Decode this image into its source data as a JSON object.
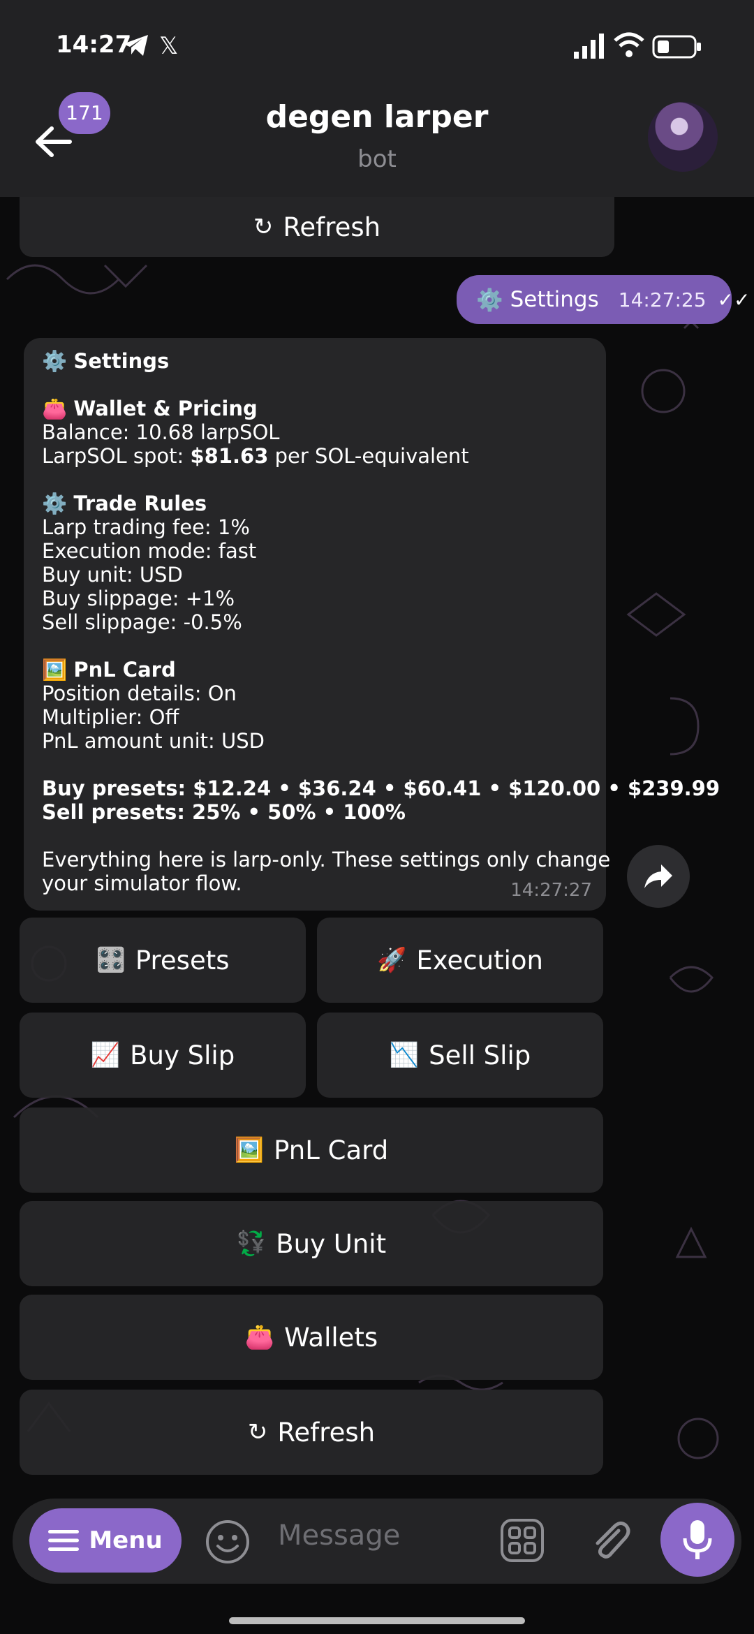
{
  "status": {
    "time": "14:27"
  },
  "header": {
    "badge": "171",
    "title": "degen larper",
    "subtitle": "bot"
  },
  "top_button": {
    "label": "Refresh",
    "icon": "↻"
  },
  "outgoing": {
    "icon": "⚙️",
    "text": "Settings",
    "time": "14:27:25"
  },
  "message": {
    "heading": "Settings",
    "wallet_heading": "Wallet & Pricing",
    "balance": "Balance: 10.68 larpSOL",
    "spot_prefix": "LarpSOL spot: ",
    "spot_value": "$81.63",
    "spot_suffix": " per SOL-equivalent",
    "rules_heading": "Trade Rules",
    "fee": "Larp trading fee: 1%",
    "exec": "Execution mode: fast",
    "buy_unit": "Buy unit: USD",
    "buy_slip": "Buy slippage: +1%",
    "sell_slip": "Sell slippage: -0.5%",
    "pnl_heading": "PnL Card",
    "position": "Position details: On",
    "multiplier": "Multiplier: Off",
    "pnl_unit": "PnL amount unit: USD",
    "buy_presets_label": "Buy presets: ",
    "buy_presets": "$12.24 • $36.24 • $60.41 • $120.00 • $239.99",
    "sell_presets_label": "Sell presets: ",
    "sell_presets": "25% • 50% • 100%",
    "footer1": "Everything here is larp-only. These settings only change",
    "footer2": "your simulator flow.",
    "time": "14:27:27"
  },
  "buttons": {
    "presets": {
      "label": "Presets",
      "icon": "🎛️"
    },
    "execution": {
      "label": "Execution",
      "icon": "🚀"
    },
    "buy_slip": {
      "label": "Buy Slip",
      "icon": "📈"
    },
    "sell_slip": {
      "label": "Sell Slip",
      "icon": "📉"
    },
    "pnl_card": {
      "label": "PnL Card",
      "icon": "🖼️"
    },
    "buy_unit": {
      "label": "Buy Unit",
      "icon": "💱"
    },
    "wallets": {
      "label": "Wallets",
      "icon": "👛"
    },
    "refresh": {
      "label": "Refresh",
      "icon": "↻"
    }
  },
  "input": {
    "menu_label": "Menu",
    "placeholder": "Message"
  },
  "colors": {
    "accent": "#8b68c9",
    "outgoing": "#7b5cb4",
    "bubble": "#262628"
  }
}
